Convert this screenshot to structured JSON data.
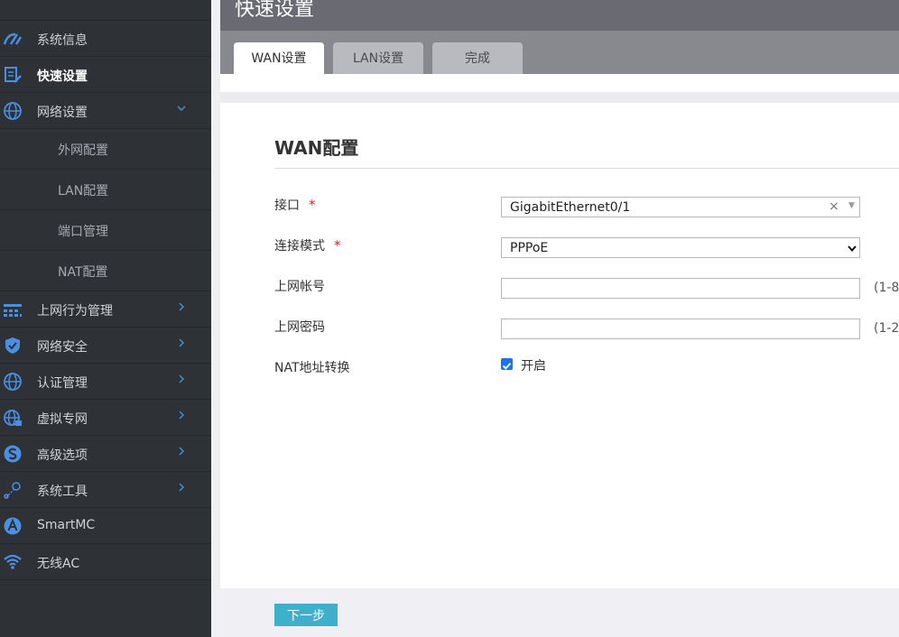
{
  "page": {
    "title": "快速设置"
  },
  "sidebar": {
    "items": [
      {
        "label": "系统信息"
      },
      {
        "label": "快速设置"
      },
      {
        "label": "网络设置"
      },
      {
        "label": "外网配置"
      },
      {
        "label": "LAN配置"
      },
      {
        "label": "端口管理"
      },
      {
        "label": "NAT配置"
      },
      {
        "label": "上网行为管理"
      },
      {
        "label": "网络安全"
      },
      {
        "label": "认证管理"
      },
      {
        "label": "虚拟专网"
      },
      {
        "label": "高级选项"
      },
      {
        "label": "系统工具"
      },
      {
        "label": "SmartMC"
      },
      {
        "label": "无线AC"
      }
    ]
  },
  "tabs": [
    {
      "label": "WAN设置"
    },
    {
      "label": "LAN设置"
    },
    {
      "label": "完成"
    }
  ],
  "form": {
    "section_title": "WAN配置",
    "interface": {
      "label": "接口",
      "required_mark": "*",
      "value": "GigabitEthernet0/1",
      "clear_glyph": "×"
    },
    "mode": {
      "label": "连接模式",
      "required_mark": "*",
      "value": "PPPoE"
    },
    "account": {
      "label": "上网帐号",
      "value": "",
      "hint": "(1-8"
    },
    "password": {
      "label": "上网密码",
      "value": "",
      "hint": "(1-2"
    },
    "nat": {
      "label": "NAT地址转换",
      "checked": true,
      "option_label": "开启"
    }
  },
  "footer": {
    "next_label": "下一步"
  },
  "colors": {
    "sidebar_bg": "#2e3136",
    "accent_blue": "#3d8fdb",
    "button_bg": "#3eb0cc",
    "required": "#e02020"
  }
}
